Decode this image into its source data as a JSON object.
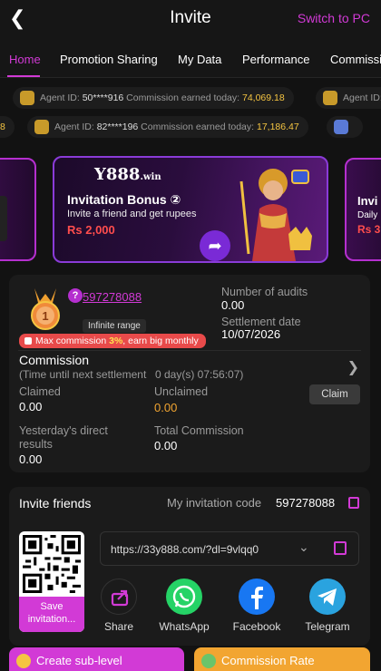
{
  "header": {
    "title": "Invite",
    "switch_label": "Switch to PC"
  },
  "tabs": [
    "Home",
    "Promotion Sharing",
    "My Data",
    "Performance",
    "Commissi"
  ],
  "ticker": [
    {
      "agent_label": "Agent ID:",
      "agent_id": "50****916",
      "earned_label": "Commission earned today:",
      "amount": "74,069.18"
    },
    {
      "agent_label": "Agent ID:",
      "agent_id": "82****196",
      "earned_label": "Commission earned today:",
      "amount": "17,186.47"
    },
    {
      "partial_left": "8",
      "partial_right": "Agent ID:"
    }
  ],
  "banner": {
    "brand": "Y888",
    "brand_suffix": ".win",
    "title": "Invitation Bonus ②",
    "subtitle": "Invite a friend and get rupees",
    "amount": "Rs 2,000",
    "next_title": "Invi",
    "next_sub": "Daily",
    "next_amt": "Rs 3"
  },
  "agent": {
    "level": "1",
    "code": "597278088",
    "range": "Infinite range",
    "max_commission_pre": "Max commission ",
    "max_commission_pct": "3%",
    "max_commission_post": ", earn big monthly",
    "audits_label": "Number of audits",
    "audits_value": "0.00",
    "settlement_label": "Settlement date",
    "settlement_value": "10/07/2026"
  },
  "commission": {
    "title": "Commission",
    "timer_label": "(Time until next settlement",
    "timer_value": "0 day(s) 07:56:07)",
    "claimed_label": "Claimed",
    "claimed_value": "0.00",
    "unclaimed_label": "Unclaimed",
    "unclaimed_value": "0.00",
    "claim_button": "Claim",
    "yesterday_label_1": "Yesterday's direct",
    "yesterday_label_2": "results",
    "yesterday_value": "0.00",
    "total_label": "Total Commission",
    "total_value": "0.00"
  },
  "invite": {
    "title": "Invite friends",
    "code_label": "My invitation code",
    "code": "597278088",
    "link": "https://33y888.com/?dl=9vlqq0",
    "save_label_1": "Save",
    "save_label_2": "invitation...",
    "share_targets": [
      {
        "label": "Share",
        "icon": "share-icon",
        "color": "#1b1b1b"
      },
      {
        "label": "WhatsApp",
        "icon": "whatsapp-icon",
        "color": "#25d366"
      },
      {
        "label": "Facebook",
        "icon": "facebook-icon",
        "color": "#1877f2"
      },
      {
        "label": "Telegram",
        "icon": "telegram-icon",
        "color": "#2aa3df"
      }
    ]
  },
  "bottom_buttons": [
    {
      "label": "Create sub-level",
      "color": "#d23ad6"
    },
    {
      "label": "Commission Rate",
      "color": "#f2a531"
    }
  ]
}
